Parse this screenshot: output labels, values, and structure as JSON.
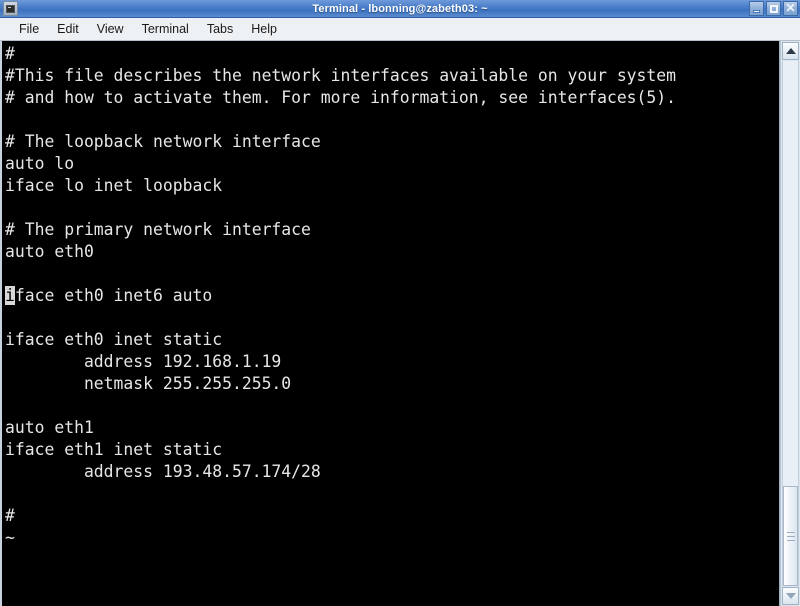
{
  "window": {
    "title": "Terminal - lbonning@zabeth03: ~",
    "app_icon": "terminal-icon",
    "controls": {
      "minimize": "minimize-icon",
      "maximize": "maximize-icon",
      "close": "close-icon"
    }
  },
  "menubar": {
    "items": [
      {
        "label": "File"
      },
      {
        "label": "Edit"
      },
      {
        "label": "View"
      },
      {
        "label": "Terminal"
      },
      {
        "label": "Tabs"
      },
      {
        "label": "Help"
      }
    ]
  },
  "terminal": {
    "foreground": "#e6e6e6",
    "background": "#000000",
    "cursor": {
      "line_index": 11,
      "column": 0,
      "character": "i"
    },
    "lines": [
      "#",
      "#This file describes the network interfaces available on your system",
      "# and how to activate them. For more information, see interfaces(5).",
      "",
      "# The loopback network interface",
      "auto lo",
      "iface lo inet loopback",
      "",
      "# The primary network interface",
      "auto eth0",
      "",
      "iface eth0 inet6 auto",
      "",
      "iface eth0 inet static",
      "        address 192.168.1.19",
      "        netmask 255.255.255.0",
      "",
      "auto eth1",
      "iface eth1 inet static",
      "        address 193.48.57.174/28",
      "",
      "#",
      "~"
    ]
  },
  "scrollbar": {
    "up_arrow": "scroll-up-icon",
    "down_arrow": "scroll-down-icon"
  }
}
